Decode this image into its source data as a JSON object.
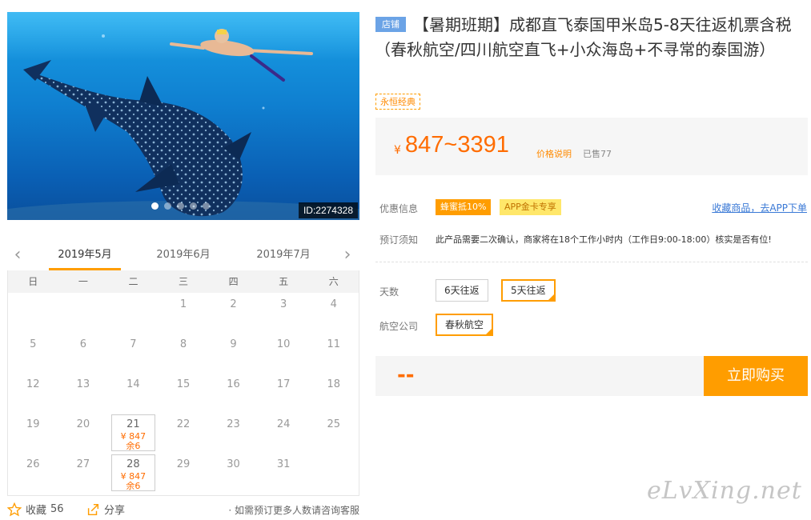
{
  "hero": {
    "id_label": "ID:2274328",
    "dots": 5,
    "active_dot": 0
  },
  "calendar": {
    "prev_label": "‹",
    "next_label": "›",
    "months": [
      "2019年5月",
      "2019年6月",
      "2019年7月"
    ],
    "active_month": 0,
    "weekdays": [
      "日",
      "一",
      "二",
      "三",
      "四",
      "五",
      "六"
    ],
    "leading_blanks": 3,
    "days": 31,
    "available": [
      {
        "day": "21",
        "price": "¥ 847",
        "stock": "余6"
      },
      {
        "day": "28",
        "price": "¥ 847",
        "stock": "余6"
      }
    ]
  },
  "footer": {
    "fav_label": "收藏",
    "fav_count": "56",
    "share_label": "分享",
    "consult_text": "· 如需预订更多人数请咨询客服"
  },
  "product": {
    "shop_badge": "店铺",
    "title": "【暑期班期】成都直飞泰国甲米岛5-8天往返机票含税（春秋航空/四川航空直飞+小众海岛+不寻常的泰国游）",
    "classic_tag": "永恒经典",
    "price_yen": "¥",
    "price_range": "847~3391",
    "price_note": "价格说明",
    "sold": "已售77"
  },
  "promo": {
    "label": "优惠信息",
    "tag1": "蜂蜜抵10%",
    "tag2": "APP金卡专享",
    "app_link": "收藏商品，去APP下单"
  },
  "booking": {
    "label": "预订须知",
    "notice": "此产品需要二次确认，商家将在18个工作小时内（工作日9:00-18:00）核实是否有位!"
  },
  "options": {
    "days_label": "天数",
    "days": [
      "6天往返",
      "5天往返"
    ],
    "days_selected": 1,
    "airline_label": "航空公司",
    "airlines": [
      "春秋航空"
    ],
    "airline_selected": 0
  },
  "buy": {
    "price_placeholder": "--",
    "button": "立即购买"
  },
  "watermark": "eLvXing.net",
  "colors": {
    "accent": "#ff9d00",
    "price": "#ff6c00",
    "badge_blue": "#6ba3e6",
    "link": "#3a79d6"
  }
}
